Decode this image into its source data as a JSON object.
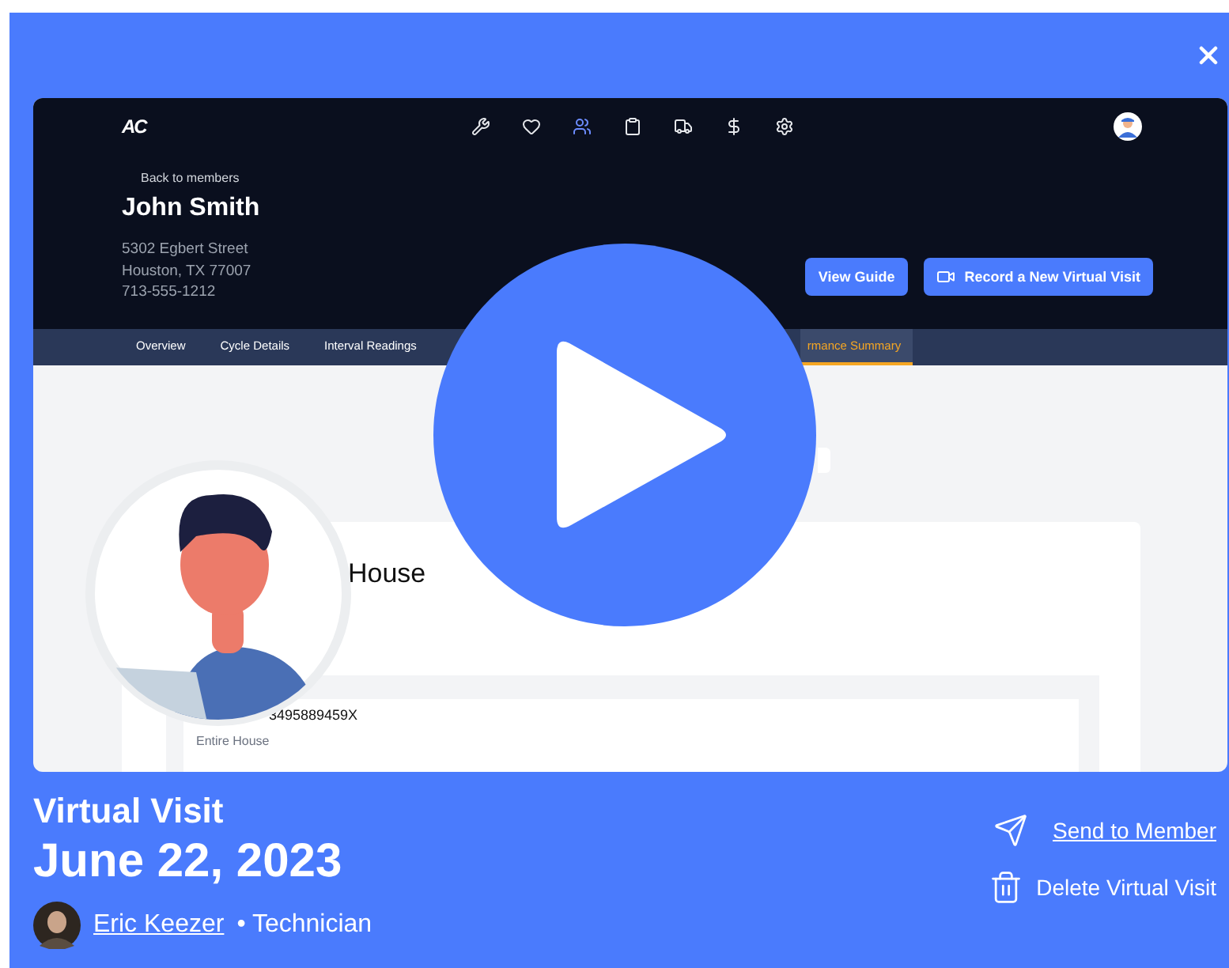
{
  "video": {
    "logo": "AC",
    "nav": [
      {
        "kind": "wrench",
        "selected": false
      },
      {
        "kind": "heart",
        "selected": false
      },
      {
        "kind": "users",
        "selected": true
      },
      {
        "kind": "clipboard",
        "selected": false
      },
      {
        "kind": "truck",
        "selected": false
      },
      {
        "kind": "dollar",
        "selected": false
      },
      {
        "kind": "settings",
        "selected": false
      }
    ],
    "back_link": "Back to members",
    "member_name": "John Smith",
    "address": [
      "5302 Egbert Street",
      "Houston, TX 77007",
      "713-555-1212"
    ],
    "buttons": [
      {
        "label": "View Guide",
        "kind": "plain"
      },
      {
        "label": "Record a New Virtual Visit",
        "kind": "video"
      }
    ],
    "tabs": [
      {
        "label": "Overview",
        "selected": false
      },
      {
        "label": "Cycle Details",
        "selected": false
      },
      {
        "label": "Interval Readings",
        "selected": false
      },
      {
        "label": "rmance Summary",
        "selected": true
      }
    ],
    "card_title": "House",
    "system_id": "3495889459X",
    "system_zone": "Entire House"
  },
  "visit": {
    "type": "Virtual Visit",
    "date": "June 22, 2023",
    "author": "Eric Keezer",
    "role": "• Technician"
  },
  "actions": [
    {
      "label": "Send to Member",
      "kind": "send",
      "link": true
    },
    {
      "label": "Delete Virtual Visit",
      "kind": "delete",
      "link": false
    }
  ]
}
